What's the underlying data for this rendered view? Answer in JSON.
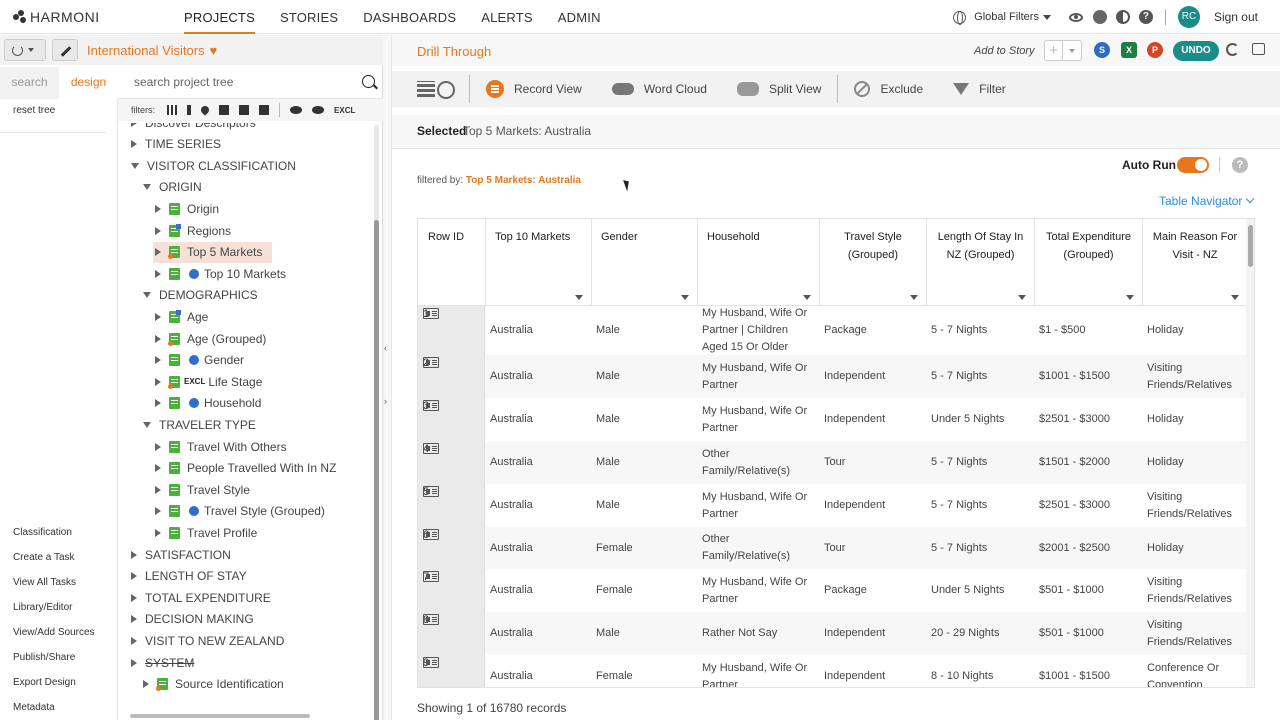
{
  "app": {
    "logo": "HARMONI"
  },
  "nav": {
    "items": [
      {
        "label": "PROJECTS",
        "active": true
      },
      {
        "label": "STORIES"
      },
      {
        "label": "DASHBOARDS"
      },
      {
        "label": "ALERTS"
      },
      {
        "label": "ADMIN"
      }
    ]
  },
  "topright": {
    "global_filters": "Global Filters",
    "avatar": "RC",
    "signout": "Sign out",
    "help": "?"
  },
  "project": {
    "title": "International Visitors"
  },
  "left": {
    "tabs": {
      "search": "search",
      "design": "design"
    },
    "search_placeholder": "search project tree",
    "reset_tree": "reset tree",
    "filters_label": "filters:",
    "excl": "EXCL",
    "side_links": [
      "Classification",
      "Create a Task",
      "View All Tasks",
      "Library/Editor",
      "View/Add Sources",
      "Publish/Share",
      "Export Design",
      "Metadata"
    ]
  },
  "tree": [
    {
      "label": "Discover Descriptors",
      "level": 0,
      "toggle": "r"
    },
    {
      "label": "TIME SERIES",
      "level": 0,
      "toggle": "r"
    },
    {
      "label": "VISITOR CLASSIFICATION",
      "level": 0,
      "toggle": "d"
    },
    {
      "label": "ORIGIN",
      "level": 1,
      "toggle": "d"
    },
    {
      "label": "Origin",
      "level": 2,
      "toggle": "r",
      "icon": "doc"
    },
    {
      "label": "Regions",
      "level": 2,
      "toggle": "r",
      "icon": "doc-blue"
    },
    {
      "label": "Top 5 Markets",
      "level": 2,
      "toggle": "r",
      "icon": "doc-orange",
      "selected": true
    },
    {
      "label": "Top 10 Markets",
      "level": 2,
      "toggle": "r",
      "icon": "doc",
      "info": true
    },
    {
      "label": "DEMOGRAPHICS",
      "level": 1,
      "toggle": "d"
    },
    {
      "label": "Age",
      "level": 2,
      "toggle": "r",
      "icon": "doc-blue"
    },
    {
      "label": "Age (Grouped)",
      "level": 2,
      "toggle": "r",
      "icon": "doc-orange"
    },
    {
      "label": "Gender",
      "level": 2,
      "toggle": "r",
      "icon": "doc",
      "info": true
    },
    {
      "label": "Life Stage",
      "level": 2,
      "toggle": "r",
      "icon": "excl"
    },
    {
      "label": "Household",
      "level": 2,
      "toggle": "r",
      "icon": "doc",
      "info": true
    },
    {
      "label": "TRAVELER TYPE",
      "level": 1,
      "toggle": "d"
    },
    {
      "label": "Travel With Others",
      "level": 2,
      "toggle": "r",
      "icon": "doc"
    },
    {
      "label": "People Travelled With In NZ",
      "level": 2,
      "toggle": "r",
      "icon": "doc"
    },
    {
      "label": "Travel Style",
      "level": 2,
      "toggle": "r",
      "icon": "doc"
    },
    {
      "label": "Travel Style (Grouped)",
      "level": 2,
      "toggle": "r",
      "icon": "doc",
      "info": true
    },
    {
      "label": "Travel Profile",
      "level": 2,
      "toggle": "r",
      "icon": "doc"
    },
    {
      "label": "SATISFACTION",
      "level": 0,
      "toggle": "r"
    },
    {
      "label": "LENGTH OF STAY",
      "level": 0,
      "toggle": "r"
    },
    {
      "label": "TOTAL EXPENDITURE",
      "level": 0,
      "toggle": "r"
    },
    {
      "label": "DECISION MAKING",
      "level": 0,
      "toggle": "r"
    },
    {
      "label": "VISIT TO NEW ZEALAND",
      "level": 0,
      "toggle": "r"
    },
    {
      "label": "SYSTEM",
      "level": 0,
      "toggle": "r",
      "strike": true
    },
    {
      "label": "Source Identification",
      "level": 1,
      "toggle": "r",
      "icon": "doc-orange"
    }
  ],
  "main": {
    "title": "Drill Through",
    "add_to_story": "Add to Story",
    "undo": "UNDO",
    "apps": [
      {
        "label": "S",
        "color": "#2b6cc4"
      },
      {
        "label": "X",
        "color": "#1e7e45"
      },
      {
        "label": "P",
        "color": "#d24726"
      }
    ],
    "toolbar": [
      {
        "label": "Record View",
        "icon": "record"
      },
      {
        "label": "Word Cloud",
        "icon": "cloud"
      },
      {
        "label": "Split View",
        "icon": "split"
      },
      {
        "label": "Exclude",
        "icon": "exclude"
      },
      {
        "label": "Filter",
        "icon": "filter"
      }
    ],
    "selected_label": "Selected",
    "selected_value": "Top 5 Markets: Australia",
    "auto_run": "Auto Run",
    "filtered_prefix": "filtered by:",
    "filtered_value": "Top 5 Markets: Australia",
    "table_navigator": "Table Navigator",
    "showing": "Showing 1 of 16780 records"
  },
  "table": {
    "columns": [
      {
        "label": "Row ID"
      },
      {
        "label": "Top 10 Markets"
      },
      {
        "label": "Gender"
      },
      {
        "label": "Household"
      },
      {
        "label": "Travel Style (Grouped)"
      },
      {
        "label": "Length Of Stay In NZ (Grouped)"
      },
      {
        "label": "Total Expenditure (Grouped)"
      },
      {
        "label": "Main Reason For Visit - NZ"
      }
    ],
    "rows": [
      {
        "id": "1",
        "market": "Australia",
        "gender": "Male",
        "household": "My Husband, Wife Or Partner | Children Aged 15 Or Older",
        "style": "Package",
        "stay": "5 - 7 Nights",
        "spend": "$1 - $500",
        "reason": "Holiday"
      },
      {
        "id": "2",
        "market": "Australia",
        "gender": "Male",
        "household": "My Husband, Wife Or Partner",
        "style": "Independent",
        "stay": "5 - 7 Nights",
        "spend": "$1001 - $1500",
        "reason": "Visiting Friends/Relatives"
      },
      {
        "id": "3",
        "market": "Australia",
        "gender": "Male",
        "household": "My Husband, Wife Or Partner",
        "style": "Independent",
        "stay": "Under 5 Nights",
        "spend": "$2501 - $3000",
        "reason": "Holiday"
      },
      {
        "id": "4",
        "market": "Australia",
        "gender": "Male",
        "household": "Other Family/Relative(s)",
        "style": "Tour",
        "stay": "5 - 7 Nights",
        "spend": "$1501 - $2000",
        "reason": "Holiday"
      },
      {
        "id": "5",
        "market": "Australia",
        "gender": "Male",
        "household": "My Husband, Wife Or Partner",
        "style": "Independent",
        "stay": "5 - 7 Nights",
        "spend": "$2501 - $3000",
        "reason": "Visiting Friends/Relatives"
      },
      {
        "id": "6",
        "market": "Australia",
        "gender": "Female",
        "household": "Other Family/Relative(s)",
        "style": "Tour",
        "stay": "5 - 7 Nights",
        "spend": "$2001 - $2500",
        "reason": "Holiday"
      },
      {
        "id": "7",
        "market": "Australia",
        "gender": "Female",
        "household": "My Husband, Wife Or Partner",
        "style": "Package",
        "stay": "Under 5 Nights",
        "spend": "$501 - $1000",
        "reason": "Visiting Friends/Relatives"
      },
      {
        "id": "8",
        "market": "Australia",
        "gender": "Male",
        "household": "Rather Not Say",
        "style": "Independent",
        "stay": "20 - 29 Nights",
        "spend": "$501 - $1000",
        "reason": "Visiting Friends/Relatives"
      },
      {
        "id": "9",
        "market": "Australia",
        "gender": "Female",
        "household": "My Husband, Wife Or Partner",
        "style": "Independent",
        "stay": "8 - 10 Nights",
        "spend": "$1001 - $1500",
        "reason": "Conference Or Convention"
      }
    ]
  }
}
